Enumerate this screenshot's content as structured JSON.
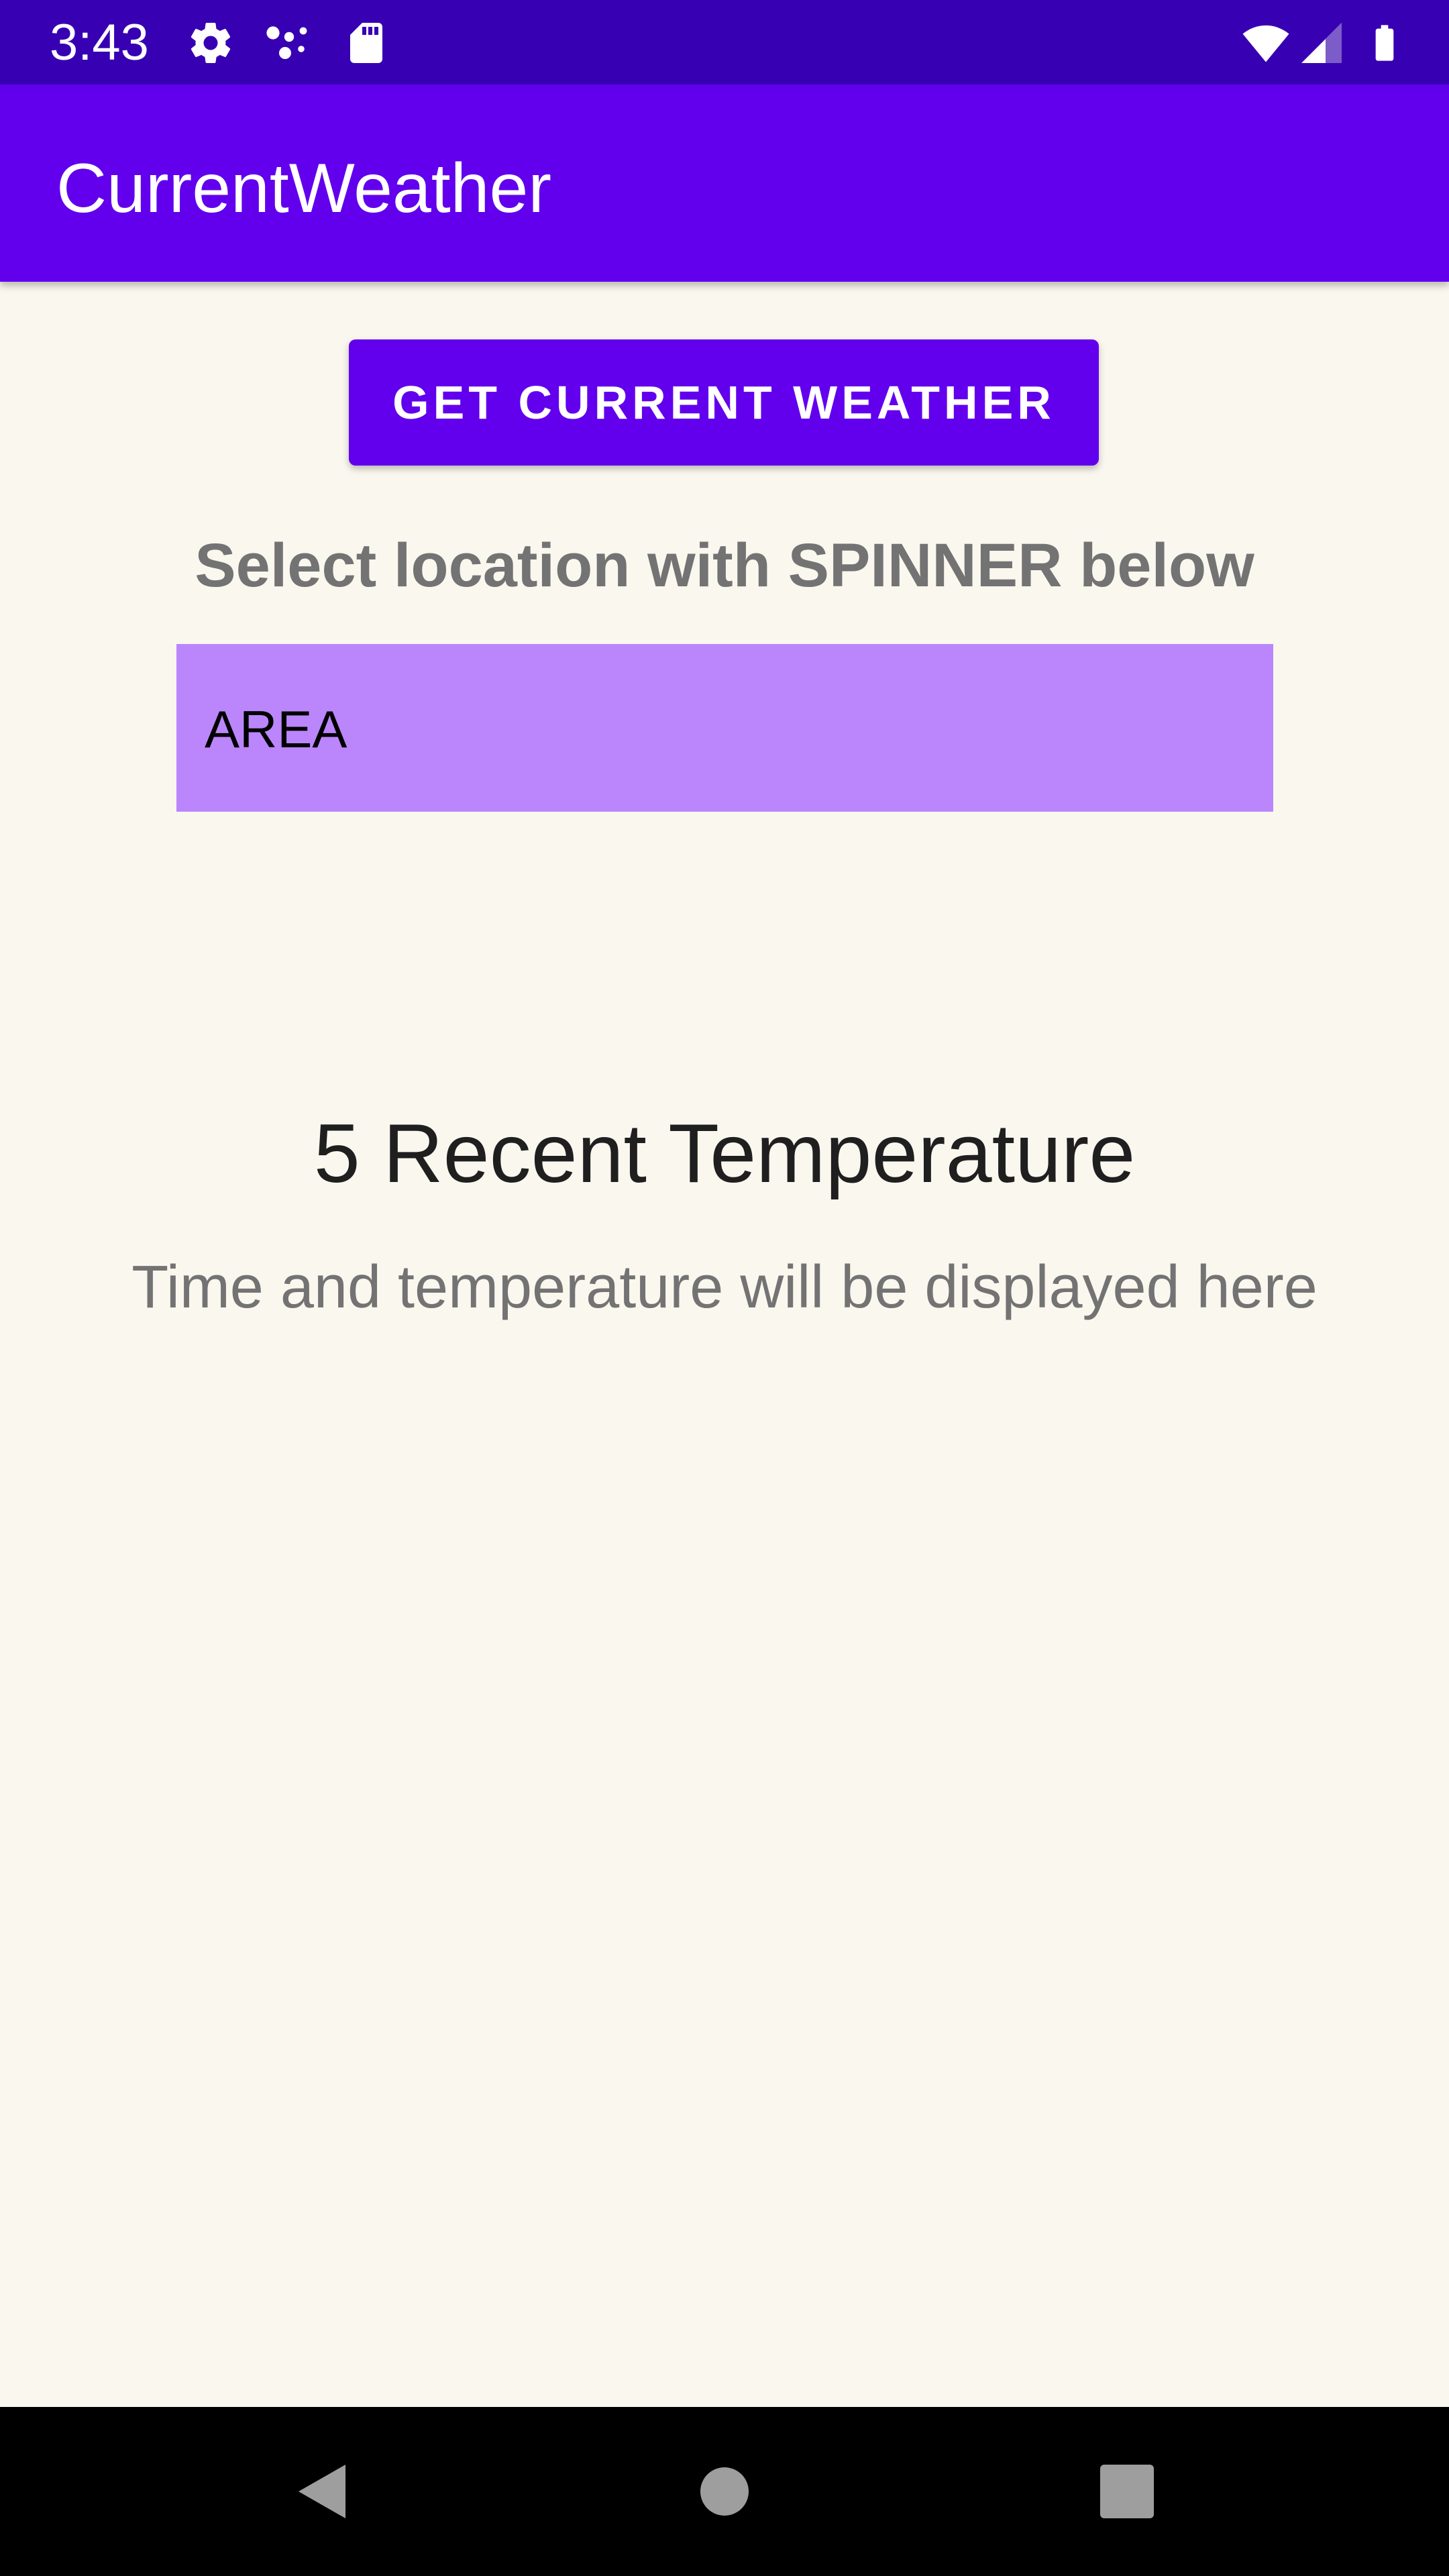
{
  "status_bar": {
    "time": "3:43",
    "icons": [
      "gear-icon",
      "dots-icon",
      "sd-card-icon",
      "wifi-icon",
      "signal-icon",
      "battery-icon"
    ]
  },
  "app_bar": {
    "title": "CurrentWeather"
  },
  "actions": {
    "get_weather_label": "GET CURRENT WEATHER"
  },
  "location": {
    "prompt": "Select location with SPINNER below",
    "selected": "AREA"
  },
  "temperatures": {
    "title": "5 Recent Temperature",
    "placeholder": "Time and temperature will be displayed here"
  },
  "nav_bar": {
    "buttons": [
      "back",
      "home",
      "recents"
    ]
  },
  "colors": {
    "status_bar": "#3700b3",
    "primary": "#6200ee",
    "spinner_bg": "#bb86fc",
    "background": "#faf7ee"
  }
}
